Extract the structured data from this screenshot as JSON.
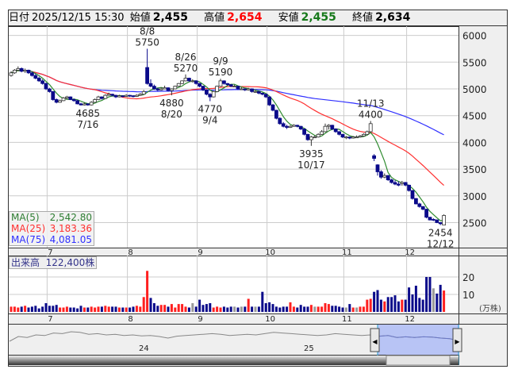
{
  "header": {
    "date_label": "日付",
    "date": "2025/12/15 15:30",
    "open_label": "始値",
    "open": "2,455",
    "high_label": "高値",
    "high": "2,654",
    "low_label": "安値",
    "low": "2,455",
    "close_label": "終値",
    "close": "2,634"
  },
  "legend": [
    {
      "name": "MA(5)",
      "value": "2,542.80",
      "color": "#2e7d32"
    },
    {
      "name": "MA(25)",
      "value": "3,183.36",
      "color": "#ff3030"
    },
    {
      "name": "MA(75)",
      "value": "4,081.05",
      "color": "#3030ff"
    }
  ],
  "volume_label": "出来高",
  "volume_value": "122,400株",
  "volume_unit": "(万株)",
  "colors": {
    "down": "#0a0a8a",
    "up_vol": "#ff2020",
    "down_vol": "#0a0a8a",
    "ma5": "#2e8b2e",
    "ma25": "#ff3030",
    "ma75": "#3030ff"
  },
  "chart_data": {
    "type": "candlestick",
    "title": "",
    "price_ticks": [
      "6000",
      "5500",
      "5000",
      "4500",
      "4000",
      "3500",
      "3000",
      "2500"
    ],
    "ylim": [
      2100,
      6150
    ],
    "volume_ticks": [
      "20",
      "10"
    ],
    "months": [
      {
        "label": "7",
        "start": 11
      },
      {
        "label": "8",
        "start": 34
      },
      {
        "label": "9",
        "start": 54
      },
      {
        "label": "10",
        "start": 74
      },
      {
        "label": "11",
        "start": 96
      },
      {
        "label": "12",
        "start": 114
      }
    ],
    "annotations": [
      {
        "lines": [
          "8/8",
          "5750"
        ],
        "idx": 39,
        "pos": "above"
      },
      {
        "lines": [
          "8/26",
          "5270"
        ],
        "idx": 50,
        "pos": "above"
      },
      {
        "lines": [
          "9/9",
          "5190"
        ],
        "idx": 60,
        "pos": "above"
      },
      {
        "lines": [
          "11/13",
          "4400"
        ],
        "idx": 103,
        "pos": "above"
      },
      {
        "lines": [
          "4685",
          "7/16"
        ],
        "idx": 22,
        "pos": "below"
      },
      {
        "lines": [
          "4880",
          "8/20"
        ],
        "idx": 46,
        "pos": "below"
      },
      {
        "lines": [
          "4770",
          "9/4"
        ],
        "idx": 57,
        "pos": "below"
      },
      {
        "lines": [
          "3935",
          "10/17"
        ],
        "idx": 86,
        "pos": "below"
      },
      {
        "lines": [
          "2454",
          "12/12"
        ],
        "idx": 123,
        "pos": "below"
      }
    ],
    "ohlc": [
      [
        5250,
        5330,
        5230,
        5300
      ],
      [
        5300,
        5370,
        5280,
        5350
      ],
      [
        5350,
        5420,
        5340,
        5380
      ],
      [
        5380,
        5400,
        5310,
        5330
      ],
      [
        5330,
        5380,
        5300,
        5350
      ],
      [
        5350,
        5360,
        5280,
        5300
      ],
      [
        5300,
        5320,
        5230,
        5250
      ],
      [
        5250,
        5280,
        5180,
        5200
      ],
      [
        5200,
        5230,
        5130,
        5150
      ],
      [
        5150,
        5180,
        5080,
        5100
      ],
      [
        5100,
        5120,
        4980,
        5000
      ],
      [
        5000,
        5020,
        4930,
        4950
      ],
      [
        4950,
        4960,
        4780,
        4800
      ],
      [
        4800,
        4820,
        4730,
        4750
      ],
      [
        4750,
        4800,
        4740,
        4780
      ],
      [
        4780,
        4850,
        4770,
        4830
      ],
      [
        4830,
        4870,
        4810,
        4850
      ],
      [
        4850,
        4860,
        4790,
        4800
      ],
      [
        4800,
        4820,
        4760,
        4780
      ],
      [
        4780,
        4790,
        4710,
        4720
      ],
      [
        4720,
        4740,
        4690,
        4700
      ],
      [
        4700,
        4750,
        4690,
        4720
      ],
      [
        4720,
        4730,
        4685,
        4700
      ],
      [
        4700,
        4770,
        4690,
        4750
      ],
      [
        4750,
        4820,
        4740,
        4800
      ],
      [
        4800,
        4870,
        4790,
        4850
      ],
      [
        4850,
        4860,
        4800,
        4820
      ],
      [
        4820,
        4900,
        4810,
        4880
      ],
      [
        4880,
        4930,
        4870,
        4900
      ],
      [
        4900,
        4910,
        4860,
        4880
      ],
      [
        4880,
        4890,
        4830,
        4850
      ],
      [
        4850,
        4890,
        4840,
        4870
      ],
      [
        4870,
        4880,
        4840,
        4860
      ],
      [
        4860,
        4900,
        4850,
        4880
      ],
      [
        4880,
        4890,
        4850,
        4870
      ],
      [
        4870,
        4880,
        4840,
        4860
      ],
      [
        4860,
        4900,
        4850,
        4880
      ],
      [
        4880,
        4920,
        4870,
        4900
      ],
      [
        4900,
        4980,
        4890,
        4950
      ],
      [
        5400,
        5750,
        5080,
        5100
      ],
      [
        5100,
        5180,
        5030,
        5050
      ],
      [
        5050,
        5080,
        4980,
        5000
      ],
      [
        5000,
        5020,
        4960,
        4980
      ],
      [
        4980,
        5030,
        4970,
        5000
      ],
      [
        5000,
        5060,
        4990,
        5020
      ],
      [
        5020,
        5030,
        4950,
        4970
      ],
      [
        4970,
        5010,
        4880,
        5000
      ],
      [
        5000,
        5060,
        4990,
        5050
      ],
      [
        5050,
        5110,
        5040,
        5100
      ],
      [
        5100,
        5160,
        5090,
        5150
      ],
      [
        5150,
        5270,
        5140,
        5200
      ],
      [
        5200,
        5210,
        5130,
        5150
      ],
      [
        5150,
        5180,
        5120,
        5150
      ],
      [
        5150,
        5160,
        5080,
        5100
      ],
      [
        5100,
        5110,
        5030,
        5050
      ],
      [
        5050,
        5060,
        4960,
        4980
      ],
      [
        4980,
        4990,
        4880,
        4900
      ],
      [
        4900,
        4920,
        4770,
        4850
      ],
      [
        4850,
        4960,
        4840,
        4950
      ],
      [
        4950,
        5060,
        4940,
        5050
      ],
      [
        5050,
        5190,
        5040,
        5150
      ],
      [
        5150,
        5160,
        5080,
        5100
      ],
      [
        5100,
        5110,
        5060,
        5080
      ],
      [
        5080,
        5090,
        5030,
        5050
      ],
      [
        5050,
        5080,
        5030,
        5050
      ],
      [
        5050,
        5060,
        4980,
        5000
      ],
      [
        5000,
        5030,
        4980,
        5000
      ],
      [
        5000,
        5010,
        4960,
        4980
      ],
      [
        4980,
        5020,
        4970,
        5000
      ],
      [
        5000,
        5010,
        4930,
        4950
      ],
      [
        4950,
        4980,
        4930,
        4950
      ],
      [
        4950,
        4960,
        4900,
        4920
      ],
      [
        4920,
        4930,
        4880,
        4900
      ],
      [
        4900,
        4910,
        4830,
        4850
      ],
      [
        4850,
        4860,
        4680,
        4700
      ],
      [
        4700,
        4720,
        4580,
        4600
      ],
      [
        4600,
        4610,
        4430,
        4450
      ],
      [
        4450,
        4470,
        4330,
        4350
      ],
      [
        4350,
        4380,
        4280,
        4300
      ],
      [
        4300,
        4330,
        4250,
        4280
      ],
      [
        4280,
        4320,
        4270,
        4300
      ],
      [
        4300,
        4340,
        4290,
        4320
      ],
      [
        4320,
        4330,
        4280,
        4300
      ],
      [
        4300,
        4310,
        4230,
        4250
      ],
      [
        4250,
        4260,
        4130,
        4150
      ],
      [
        4150,
        4160,
        4030,
        4050
      ],
      [
        4050,
        4120,
        3935,
        4100
      ],
      [
        4100,
        4130,
        4080,
        4100
      ],
      [
        4100,
        4170,
        4090,
        4150
      ],
      [
        4150,
        4230,
        4140,
        4200
      ],
      [
        4200,
        4350,
        4190,
        4300
      ],
      [
        4300,
        4340,
        4240,
        4320
      ],
      [
        4320,
        4330,
        4230,
        4250
      ],
      [
        4250,
        4260,
        4180,
        4200
      ],
      [
        4200,
        4210,
        4130,
        4150
      ],
      [
        4150,
        4160,
        4080,
        4100
      ],
      [
        4100,
        4120,
        4060,
        4100
      ],
      [
        4100,
        4110,
        4060,
        4080
      ],
      [
        4080,
        4120,
        4070,
        4100
      ],
      [
        4100,
        4130,
        4080,
        4100
      ],
      [
        4100,
        4140,
        4090,
        4120
      ],
      [
        4120,
        4170,
        4110,
        4150
      ],
      [
        4150,
        4220,
        4140,
        4200
      ],
      [
        4200,
        4400,
        4190,
        4350
      ],
      [
        3750,
        3780,
        3650,
        3700
      ],
      [
        3580,
        3590,
        3380,
        3450
      ],
      [
        3450,
        3480,
        3320,
        3350
      ],
      [
        3350,
        3420,
        3330,
        3380
      ],
      [
        3380,
        3390,
        3280,
        3300
      ],
      [
        3300,
        3320,
        3230,
        3250
      ],
      [
        3250,
        3290,
        3200,
        3220
      ],
      [
        3220,
        3270,
        3180,
        3200
      ],
      [
        3230,
        3280,
        3190,
        3250
      ],
      [
        3250,
        3260,
        3180,
        3200
      ],
      [
        3200,
        3210,
        3080,
        3100
      ],
      [
        3100,
        3110,
        2930,
        2950
      ],
      [
        2950,
        2960,
        2840,
        2850
      ],
      [
        2850,
        2870,
        2780,
        2800
      ],
      [
        2800,
        2810,
        2730,
        2750
      ],
      [
        2750,
        2760,
        2580,
        2600
      ],
      [
        2600,
        2610,
        2540,
        2550
      ],
      [
        2560,
        2580,
        2530,
        2550
      ],
      [
        2550,
        2560,
        2490,
        2500
      ],
      [
        2500,
        2510,
        2454,
        2480
      ],
      [
        2455,
        2654,
        2455,
        2634
      ]
    ],
    "volume": [
      3,
      3,
      2.5,
      3,
      3.5,
      2.5,
      3,
      3.5,
      2,
      3,
      5,
      3.5,
      3.5,
      4,
      2.5,
      2.5,
      3,
      2.5,
      2.5,
      2,
      3.5,
      2.5,
      2.5,
      3,
      2.5,
      3,
      3,
      3.5,
      3,
      3,
      3,
      2.5,
      2.5,
      2.5,
      2.5,
      3,
      3.5,
      3,
      8.5,
      23.5,
      8,
      5,
      3.5,
      4,
      4,
      3,
      4.5,
      2.5,
      4.5,
      4.5,
      3,
      2.5,
      5,
      3,
      7,
      4,
      4.5,
      5,
      2.5,
      3,
      2.5,
      3,
      2.5,
      3,
      3,
      2.5,
      3,
      3,
      7.5,
      3,
      3,
      3,
      11.5,
      5,
      5.5,
      4.5,
      3,
      2.5,
      3,
      3,
      5.5,
      3,
      2.5,
      4,
      3,
      3,
      4,
      3,
      3,
      3,
      5,
      4.5,
      3.5,
      3.5,
      3,
      2.5,
      2.5,
      4.5,
      2.5,
      2.5,
      3,
      3,
      7,
      7.5,
      11.5,
      12.5,
      7,
      6,
      8.5,
      8.5,
      9.5,
      6,
      7,
      7,
      14,
      10,
      15,
      8,
      7,
      20,
      20,
      13.5,
      10.5,
      15.5,
      12.24
    ]
  },
  "navigator": {
    "labels": [
      "24",
      "25"
    ],
    "history": [
      40,
      55,
      52,
      60,
      58,
      66,
      64,
      70,
      68,
      62,
      64,
      60,
      62,
      58,
      60,
      57,
      58,
      55,
      50,
      56,
      58,
      60,
      62,
      64,
      62,
      58,
      60,
      62,
      60,
      64,
      68,
      66,
      64,
      62,
      60,
      58,
      60,
      64,
      62,
      60,
      58,
      60,
      56,
      58,
      52,
      54,
      52,
      54,
      53,
      50,
      48,
      42
    ]
  }
}
